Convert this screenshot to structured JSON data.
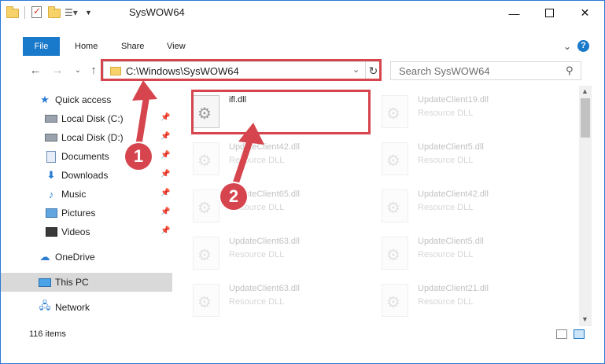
{
  "window": {
    "title": "SysWOW64"
  },
  "ribbon": {
    "tabs": [
      "File",
      "Home",
      "Share",
      "View"
    ]
  },
  "address": {
    "path": "C:\\Windows\\SysWOW64"
  },
  "search": {
    "placeholder": "Search SysWOW64"
  },
  "sidebar": {
    "items": [
      {
        "label": "Quick access",
        "icon": "star-icon"
      },
      {
        "label": "Local Disk (C:)",
        "icon": "disk-icon",
        "pinned": true
      },
      {
        "label": "Local Disk (D:)",
        "icon": "disk-icon",
        "pinned": true
      },
      {
        "label": "Documents",
        "icon": "documents-icon",
        "pinned": true
      },
      {
        "label": "Downloads",
        "icon": "download-icon",
        "pinned": true
      },
      {
        "label": "Music",
        "icon": "music-icon",
        "pinned": true
      },
      {
        "label": "Pictures",
        "icon": "pictures-icon",
        "pinned": true
      },
      {
        "label": "Videos",
        "icon": "videos-icon",
        "pinned": true
      },
      {
        "label": "OneDrive",
        "icon": "cloud-icon"
      },
      {
        "label": "This PC",
        "icon": "computer-icon",
        "selected": true
      },
      {
        "label": "Network",
        "icon": "network-icon"
      }
    ]
  },
  "files": {
    "items": [
      {
        "name": "ifl.dll",
        "type": ""
      },
      {
        "name": "UpdateClient19.dll",
        "type": "Resource DLL"
      },
      {
        "name": "UpdateClient42.dll",
        "type": "Resource DLL"
      },
      {
        "name": "UpdateClient5.dll",
        "type": "Resource DLL"
      },
      {
        "name": "UpdateClient65.dll",
        "type": "Resource DLL"
      },
      {
        "name": "UpdateClient42.dll",
        "type": "Resource DLL"
      },
      {
        "name": "UpdateClient63.dll",
        "type": "Resource DLL"
      },
      {
        "name": "UpdateClient5.dll",
        "type": "Resource DLL"
      },
      {
        "name": "UpdateClient63.dll",
        "type": "Resource DLL"
      },
      {
        "name": "UpdateClient21.dll",
        "type": "Resource DLL"
      }
    ]
  },
  "status": {
    "count": "116 items"
  },
  "annotations": {
    "step1": "1",
    "step2": "2",
    "color": "#d6454e"
  },
  "colors": {
    "accent": "#1979ca",
    "highlight": "#d6454e"
  }
}
